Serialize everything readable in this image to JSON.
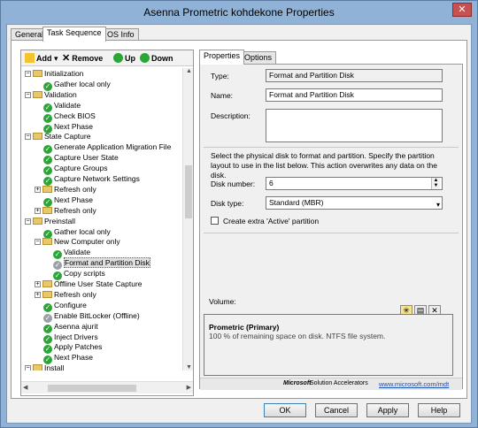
{
  "window": {
    "title": "Asenna Prometric kohdekone Properties",
    "close_label": "✕"
  },
  "main_tabs": [
    {
      "label": "General"
    },
    {
      "label": "Task Sequence"
    },
    {
      "label": "OS Info"
    }
  ],
  "toolbar": {
    "add": "Add",
    "remove": "Remove",
    "up": "Up",
    "down": "Down"
  },
  "tree": [
    {
      "label": "Initialization",
      "kind": "folder",
      "expander": "−"
    },
    {
      "label": "Gather local only",
      "kind": "step"
    },
    {
      "label": "Validation",
      "kind": "folder",
      "expander": "−"
    },
    {
      "label": "Validate",
      "kind": "step"
    },
    {
      "label": "Check BIOS",
      "kind": "step"
    },
    {
      "label": "Next Phase",
      "kind": "step"
    },
    {
      "label": "State Capture",
      "kind": "folder",
      "expander": "−"
    },
    {
      "label": "Generate Application Migration File",
      "kind": "step"
    },
    {
      "label": "Capture User State",
      "kind": "step"
    },
    {
      "label": "Capture Groups",
      "kind": "step"
    },
    {
      "label": "Capture Network Settings",
      "kind": "step"
    },
    {
      "label": "Refresh only",
      "kind": "folder",
      "expander": "+"
    },
    {
      "label": "Next Phase",
      "kind": "step"
    },
    {
      "label": "Refresh only",
      "kind": "folder",
      "expander": "+"
    },
    {
      "label": "Preinstall",
      "kind": "folder",
      "expander": "−"
    },
    {
      "label": "Gather local only",
      "kind": "step"
    },
    {
      "label": "New Computer only",
      "kind": "folder",
      "expander": "−"
    },
    {
      "label": "Validate",
      "kind": "step"
    },
    {
      "label": "Format and Partition Disk",
      "kind": "step-gray",
      "selected": true
    },
    {
      "label": "Copy scripts",
      "kind": "step"
    },
    {
      "label": "Offline User State Capture",
      "kind": "folder",
      "expander": "+"
    },
    {
      "label": "Refresh only",
      "kind": "folder",
      "expander": "+"
    },
    {
      "label": "Configure",
      "kind": "step"
    },
    {
      "label": "Enable BitLocker (Offline)",
      "kind": "step-gray"
    },
    {
      "label": "Asenna ajurit",
      "kind": "step"
    },
    {
      "label": "Inject Drivers",
      "kind": "step"
    },
    {
      "label": "Apply Patches",
      "kind": "step"
    },
    {
      "label": "Next Phase",
      "kind": "step"
    },
    {
      "label": "Install",
      "kind": "folder",
      "expander": "−"
    }
  ],
  "right_tabs": [
    {
      "label": "Properties"
    },
    {
      "label": "Options"
    }
  ],
  "properties": {
    "type_label": "Type:",
    "type_value": "Format and Partition Disk",
    "name_label": "Name:",
    "name_value": "Format and Partition Disk",
    "description_label": "Description:",
    "instructions": "Select the physical disk to format and partition.  Specify the partition layout to use in the list below. This action overwrites any data on the disk.",
    "disk_number_label": "Disk number:",
    "disk_number_value": "6",
    "disk_type_label": "Disk type:",
    "disk_type_value": "Standard (MBR)",
    "extra_partition_label": "Create extra 'Active' partition",
    "volume_label": "Volume:",
    "volume_name": "Prometric (Primary)",
    "volume_desc": "100 % of remaining space on disk. NTFS file system."
  },
  "footer": {
    "logo": "Microsoft",
    "suite": "Solution Accelerators",
    "link": "www.microsoft.com/mdt"
  },
  "buttons": {
    "ok": "OK",
    "cancel": "Cancel",
    "apply": "Apply",
    "help": "Help"
  }
}
